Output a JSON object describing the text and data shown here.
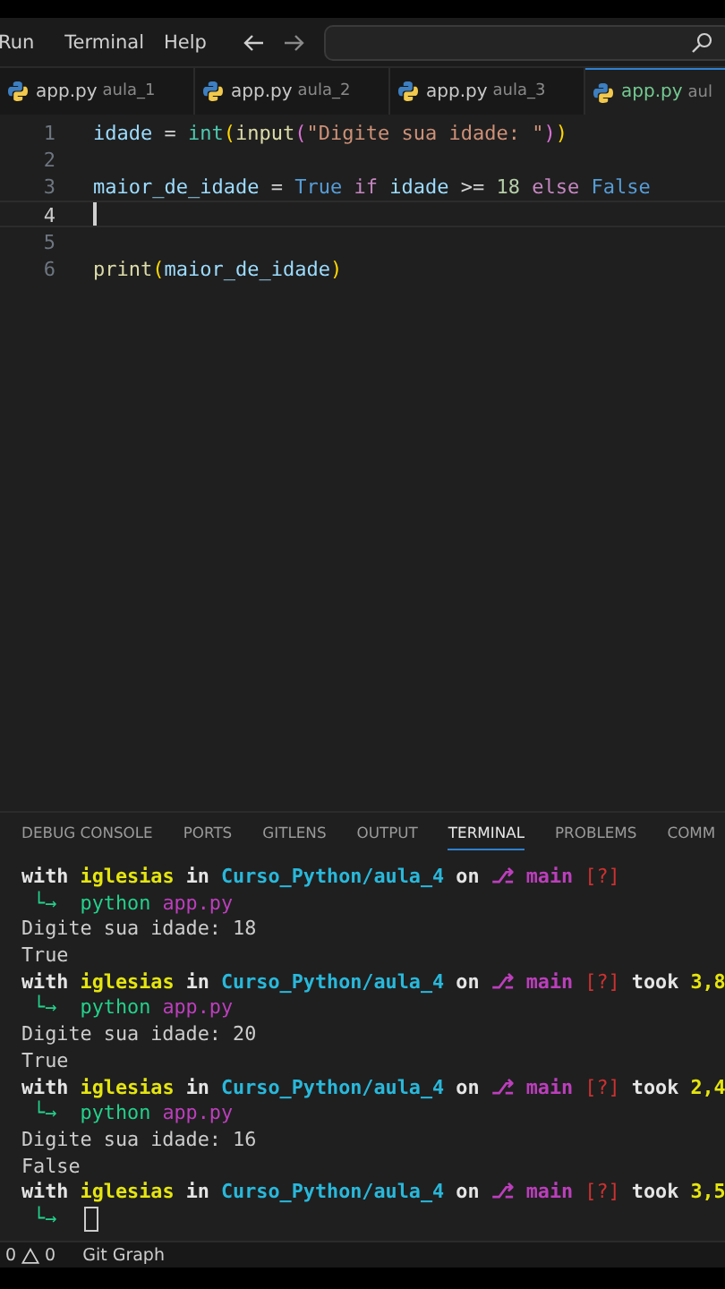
{
  "menu": [
    {
      "label": "Run"
    },
    {
      "label": "Terminal"
    },
    {
      "label": "Help"
    }
  ],
  "tabs": [
    {
      "name": "app.py",
      "folder": "aula_1",
      "selected": false
    },
    {
      "name": "app.py",
      "folder": "aula_2",
      "selected": false
    },
    {
      "name": "app.py",
      "folder": "aula_3",
      "selected": false
    },
    {
      "name": "app.py",
      "folder": "aul",
      "selected": true
    }
  ],
  "code_lines": [
    {
      "number": "1",
      "active": false,
      "tokens": [
        {
          "text": "idade",
          "kind": "var"
        },
        {
          "text": " = ",
          "kind": "plain"
        },
        {
          "text": "int",
          "kind": "type"
        },
        {
          "text": "(",
          "kind": "paren1"
        },
        {
          "text": "input",
          "kind": "func"
        },
        {
          "text": "(",
          "kind": "paren2"
        },
        {
          "text": "\"Digite sua idade: \"",
          "kind": "string"
        },
        {
          "text": ")",
          "kind": "paren2"
        },
        {
          "text": ")",
          "kind": "paren1"
        }
      ]
    },
    {
      "number": "2",
      "active": false
    },
    {
      "number": "3",
      "active": false,
      "tokens": [
        {
          "text": "maior_de_idade",
          "kind": "var"
        },
        {
          "text": " = ",
          "kind": "plain"
        },
        {
          "text": "True",
          "kind": "constant"
        },
        {
          "text": " if ",
          "kind": "control"
        },
        {
          "text": "idade",
          "kind": "var"
        },
        {
          "text": " >= ",
          "kind": "plain"
        },
        {
          "text": "18",
          "kind": "number"
        },
        {
          "text": " else ",
          "kind": "control"
        },
        {
          "text": "False",
          "kind": "constant"
        }
      ]
    },
    {
      "number": "4",
      "active": true
    },
    {
      "number": "5",
      "active": false
    },
    {
      "number": "6",
      "active": false,
      "tokens": [
        {
          "text": "print",
          "kind": "func"
        },
        {
          "text": "(",
          "kind": "paren1"
        },
        {
          "text": "maior_de_idade",
          "kind": "var"
        },
        {
          "text": ")",
          "kind": "paren1"
        }
      ]
    }
  ],
  "panel_tabs": [
    {
      "label": "DEBUG CONSOLE",
      "selected": false
    },
    {
      "label": "PORTS",
      "selected": false
    },
    {
      "label": "GITLENS",
      "selected": false
    },
    {
      "label": "OUTPUT",
      "selected": false
    },
    {
      "label": "TERMINAL",
      "selected": true
    },
    {
      "label": "PROBLEMS",
      "selected": false
    },
    {
      "label": "COMM",
      "selected": false
    }
  ],
  "terminal_lines": [
    [
      {
        "text": "with ",
        "kind": "word"
      },
      {
        "text": "iglesias",
        "kind": "user"
      },
      {
        "text": " in ",
        "kind": "word"
      },
      {
        "text": "Curso_Python/aula_4",
        "kind": "path"
      },
      {
        "text": " on ",
        "kind": "word"
      },
      {
        "text": "⎇ main",
        "kind": "branch"
      },
      {
        "text": " [?]",
        "kind": "status"
      }
    ],
    [
      {
        "text": " └→  ",
        "kind": "arrow"
      },
      {
        "text": "python",
        "kind": "command"
      },
      {
        "text": " app.py",
        "kind": "argument"
      }
    ],
    [
      {
        "text": "Digite sua idade: 18",
        "kind": "plain"
      }
    ],
    [
      {
        "text": "True",
        "kind": "plain"
      }
    ],
    [
      {
        "text": "with ",
        "kind": "word"
      },
      {
        "text": "iglesias",
        "kind": "user"
      },
      {
        "text": " in ",
        "kind": "word"
      },
      {
        "text": "Curso_Python/aula_4",
        "kind": "path"
      },
      {
        "text": " on ",
        "kind": "word"
      },
      {
        "text": "⎇ main",
        "kind": "branch"
      },
      {
        "text": " [?]",
        "kind": "status"
      },
      {
        "text": " took ",
        "kind": "word"
      },
      {
        "text": "3,8",
        "kind": "duration"
      }
    ],
    [
      {
        "text": " └→  ",
        "kind": "arrow"
      },
      {
        "text": "python",
        "kind": "command"
      },
      {
        "text": " app.py",
        "kind": "argument"
      }
    ],
    [
      {
        "text": "Digite sua idade: 20",
        "kind": "plain"
      }
    ],
    [
      {
        "text": "True",
        "kind": "plain"
      }
    ],
    [
      {
        "text": "with ",
        "kind": "word"
      },
      {
        "text": "iglesias",
        "kind": "user"
      },
      {
        "text": " in ",
        "kind": "word"
      },
      {
        "text": "Curso_Python/aula_4",
        "kind": "path"
      },
      {
        "text": " on ",
        "kind": "word"
      },
      {
        "text": "⎇ main",
        "kind": "branch"
      },
      {
        "text": " [?]",
        "kind": "status"
      },
      {
        "text": " took ",
        "kind": "word"
      },
      {
        "text": "2,4",
        "kind": "duration"
      }
    ],
    [
      {
        "text": " └→  ",
        "kind": "arrow"
      },
      {
        "text": "python",
        "kind": "command"
      },
      {
        "text": " app.py",
        "kind": "argument"
      }
    ],
    [
      {
        "text": "Digite sua idade: 16",
        "kind": "plain"
      }
    ],
    [
      {
        "text": "False",
        "kind": "plain"
      }
    ],
    [
      {
        "text": "with ",
        "kind": "word"
      },
      {
        "text": "iglesias",
        "kind": "user"
      },
      {
        "text": " in ",
        "kind": "word"
      },
      {
        "text": "Curso_Python/aula_4",
        "kind": "path"
      },
      {
        "text": " on ",
        "kind": "word"
      },
      {
        "text": "⎇ main",
        "kind": "branch"
      },
      {
        "text": " [?]",
        "kind": "status"
      },
      {
        "text": " took ",
        "kind": "word"
      },
      {
        "text": "3,5",
        "kind": "duration"
      }
    ],
    [
      {
        "text": " └→",
        "kind": "arrow"
      }
    ]
  ],
  "status_bar": {
    "errors": "0",
    "warnings": "0",
    "git_graph": "Git Graph"
  }
}
